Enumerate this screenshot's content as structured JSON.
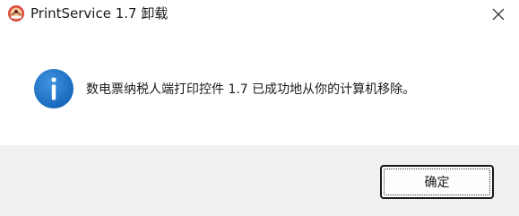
{
  "window": {
    "title": "PrintService 1.7 卸载",
    "app_icon": "app-logo-icon",
    "close_icon": "close-icon"
  },
  "content": {
    "icon": "info-icon",
    "message": "数电票纳税人端打印控件 1.7 已成功地从你的计算机移除。"
  },
  "footer": {
    "ok_label": "确定"
  },
  "colors": {
    "info_blue": "#1e73c8",
    "footer_bg": "#f0f0f0",
    "app_icon_red": "#d9463a"
  }
}
